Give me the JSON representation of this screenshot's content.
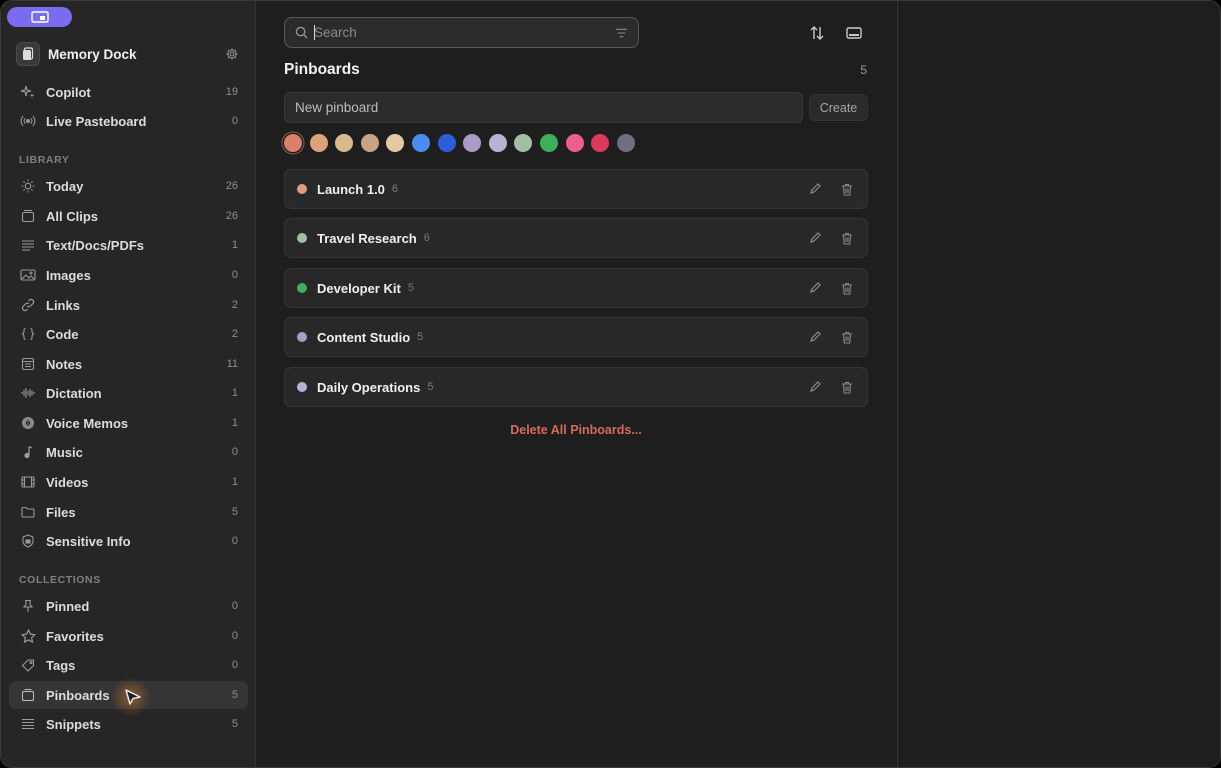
{
  "app": {
    "name": "Memory Dock"
  },
  "sidebar": {
    "top_items": [
      {
        "label": "Copilot",
        "count": "19",
        "icon": "sparkle-icon"
      },
      {
        "label": "Live Pasteboard",
        "count": "0",
        "icon": "broadcast-icon"
      }
    ],
    "library_title": "LIBRARY",
    "library": [
      {
        "label": "Today",
        "count": "26",
        "icon": "sun-icon"
      },
      {
        "label": "All Clips",
        "count": "26",
        "icon": "clips-icon"
      },
      {
        "label": "Text/Docs/PDFs",
        "count": "1",
        "icon": "text-lines-icon"
      },
      {
        "label": "Images",
        "count": "0",
        "icon": "image-icon"
      },
      {
        "label": "Links",
        "count": "2",
        "icon": "link-icon"
      },
      {
        "label": "Code",
        "count": "2",
        "icon": "code-braces-icon"
      },
      {
        "label": "Notes",
        "count": "11",
        "icon": "note-icon"
      },
      {
        "label": "Dictation",
        "count": "1",
        "icon": "waveform-icon"
      },
      {
        "label": "Voice Memos",
        "count": "1",
        "icon": "voice-memo-icon"
      },
      {
        "label": "Music",
        "count": "0",
        "icon": "music-note-icon"
      },
      {
        "label": "Videos",
        "count": "1",
        "icon": "film-icon"
      },
      {
        "label": "Files",
        "count": "5",
        "icon": "folder-icon"
      },
      {
        "label": "Sensitive Info",
        "count": "0",
        "icon": "shield-icon"
      }
    ],
    "collections_title": "COLLECTIONS",
    "collections": [
      {
        "label": "Pinned",
        "count": "0",
        "icon": "pin-icon"
      },
      {
        "label": "Favorites",
        "count": "0",
        "icon": "star-icon"
      },
      {
        "label": "Tags",
        "count": "0",
        "icon": "tag-icon"
      },
      {
        "label": "Pinboards",
        "count": "5",
        "icon": "pinboard-icon",
        "active": true
      },
      {
        "label": "Snippets",
        "count": "5",
        "icon": "snippets-icon"
      }
    ]
  },
  "main": {
    "search_placeholder": "Search",
    "title": "Pinboards",
    "count": "5",
    "new_placeholder": "New pinboard",
    "create_label": "Create",
    "swatches": [
      "#d9806a",
      "#dca278",
      "#d8bb8c",
      "#c9a383",
      "#e2c9a4",
      "#4a8df0",
      "#2b5fd9",
      "#a99cc4",
      "#bab2d6",
      "#9fc0a3",
      "#3fae5a",
      "#ee5f88",
      "#db3a5a",
      "#6c7080"
    ],
    "selected_swatch": "#d9806a",
    "pinboards": [
      {
        "name": "Launch 1.0",
        "count": "6",
        "color": "#d9a07a"
      },
      {
        "name": "Travel Research",
        "count": "6",
        "color": "#9fc0a3"
      },
      {
        "name": "Developer Kit",
        "count": "5",
        "color": "#3fae5a"
      },
      {
        "name": "Content Studio",
        "count": "5",
        "color": "#a99cc4"
      },
      {
        "name": "Daily Operations",
        "count": "5",
        "color": "#bab2d6"
      }
    ],
    "delete_all_label": "Delete All Pinboards..."
  }
}
